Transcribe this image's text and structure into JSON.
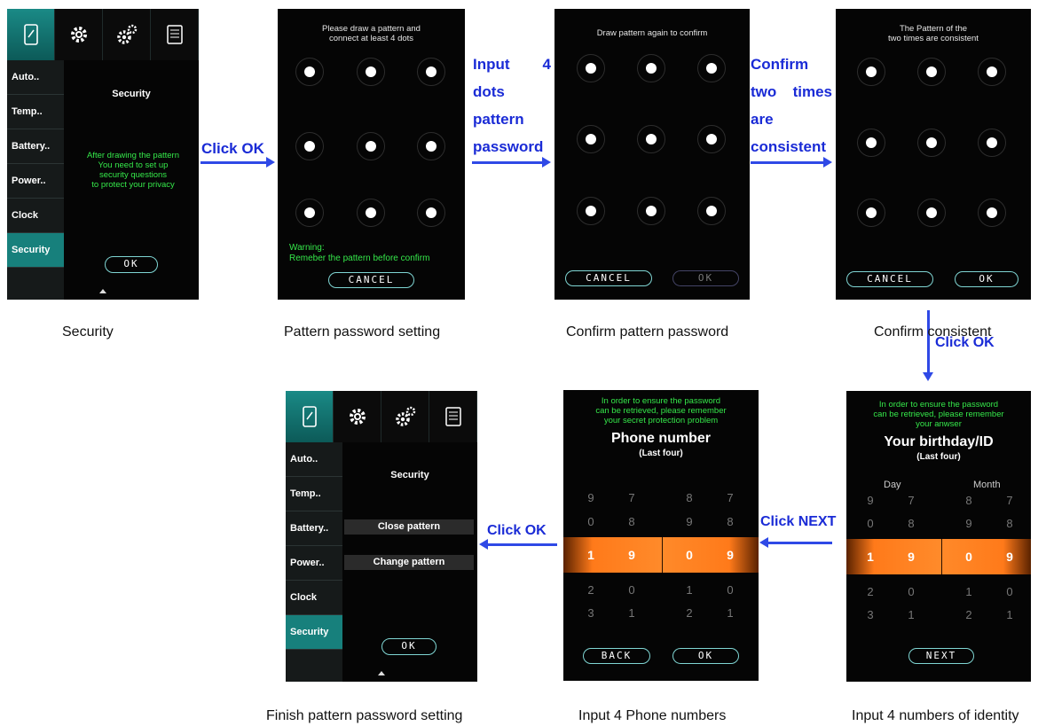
{
  "colors": {
    "teal": "#17807c",
    "green_text": "#35e84a",
    "arrow": "#2f49e6",
    "label_blue": "#1a2bd6",
    "orange": "#ff7a1a"
  },
  "settings_tabs": [
    "phone-icon",
    "gear-icon",
    "gears-icon",
    "document-icon"
  ],
  "settings_sidebar": [
    "Auto..",
    "Temp..",
    "Battery..",
    "Power..",
    "Clock",
    "Security"
  ],
  "screen1": {
    "title": "Security",
    "message": [
      "After drawing the pattern",
      "You need to set up",
      "security questions",
      "to protect your privacy"
    ],
    "ok": "OK"
  },
  "screen2": {
    "header": [
      "Please draw a pattern and",
      "connect at least 4 dots"
    ],
    "warning": [
      "Warning:",
      "Remeber the pattern before confirm"
    ],
    "cancel": "CANCEL"
  },
  "screen3": {
    "header": "Draw pattern again to confirm",
    "cancel": "CANCEL",
    "ok": "OK"
  },
  "screen4": {
    "header": [
      "The Pattern of the",
      "two times are consistent"
    ],
    "cancel": "CANCEL",
    "ok": "OK"
  },
  "screen5": {
    "header": [
      "In order to ensure the password",
      "can be retrieved, please remember",
      "your anwser"
    ],
    "title": "Your birthday/ID",
    "subtitle": "(Last four)",
    "col_day": "Day",
    "col_month": "Month",
    "rows_above": [
      [
        "9",
        "7",
        "8",
        "7"
      ],
      [
        "0",
        "8",
        "9",
        "8"
      ]
    ],
    "selected": [
      "1",
      "9",
      "0",
      "9"
    ],
    "rows_below": [
      [
        "2",
        "0",
        "1",
        "0"
      ],
      [
        "3",
        "1",
        "2",
        "1"
      ]
    ],
    "next": "NEXT"
  },
  "screen6": {
    "header": [
      "In order to ensure the password",
      "can be retrieved, please remember",
      "your secret protection problem"
    ],
    "title": "Phone number",
    "subtitle": "(Last four)",
    "rows_above": [
      [
        "9",
        "7",
        "8",
        "7"
      ],
      [
        "0",
        "8",
        "9",
        "8"
      ]
    ],
    "selected": [
      "1",
      "9",
      "0",
      "9"
    ],
    "rows_below": [
      [
        "2",
        "0",
        "1",
        "0"
      ],
      [
        "3",
        "1",
        "2",
        "1"
      ]
    ],
    "back": "BACK",
    "ok": "OK"
  },
  "screen7": {
    "title": "Security",
    "menu": [
      "Close pattern",
      "Change pattern"
    ],
    "ok": "OK"
  },
  "flow": {
    "click_ok": "Click OK",
    "input_dots": [
      "Input",
      "4",
      "dots",
      "pattern",
      "password"
    ],
    "confirm": [
      "Confirm",
      "two",
      "times",
      "are",
      "consistent"
    ],
    "click_ok_2": "Click OK",
    "click_next": "Click NEXT",
    "click_ok_3": "Click OK"
  },
  "captions": {
    "c1": "Security",
    "c2": "Pattern password setting",
    "c3": "Confirm pattern password",
    "c4": "Confirm consistent",
    "c5": "Input 4 numbers of identity",
    "c6": "Input 4 Phone numbers",
    "c7": "Finish pattern password setting"
  }
}
